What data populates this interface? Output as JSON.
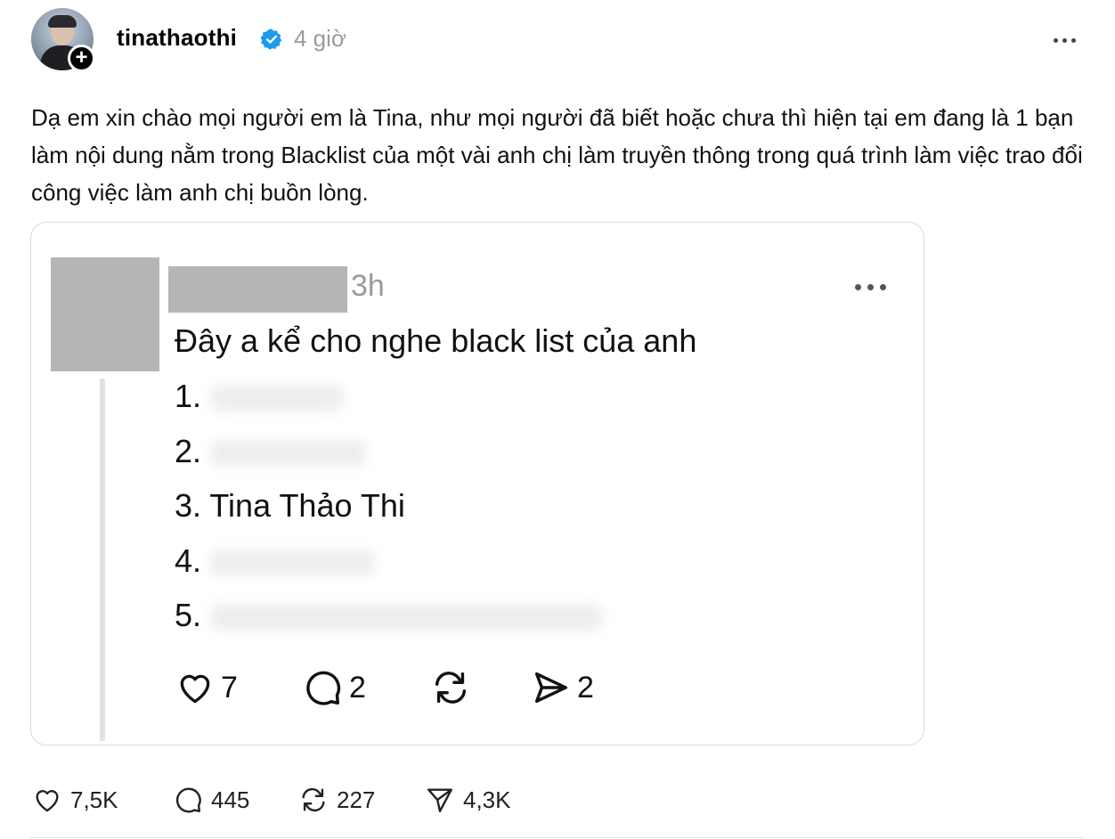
{
  "post": {
    "username": "tinathaothi",
    "time": "4 giờ",
    "caption": "Dạ em xin chào mọi người em là Tina, như mọi người đã biết hoặc chưa thì hiện tại em đang là 1 bạn làm nội dung nằm trong Blacklist của một vài anh chị làm truyền thông trong quá trình làm việc trao đổi công việc làm anh chị buồn lòng.",
    "verified_color": "#1d9bf0",
    "icons": [
      "follow-plus-icon",
      "verified-icon",
      "more-icon"
    ]
  },
  "embedded": {
    "time": "3h",
    "text": "Đây a kể cho nghe black list của anh",
    "list": [
      {
        "number": "1.",
        "name": ""
      },
      {
        "number": "2.",
        "name": ""
      },
      {
        "number": "3.",
        "name": "Tina Thảo Thi"
      },
      {
        "number": "4.",
        "name": ""
      },
      {
        "number": "5.",
        "name": ""
      }
    ],
    "actions": {
      "likes": "7",
      "replies": "2",
      "reposts": "",
      "shares": "2"
    }
  },
  "actions": {
    "likes": "7,5K",
    "replies": "445",
    "reposts": "227",
    "shares": "4,3K"
  }
}
